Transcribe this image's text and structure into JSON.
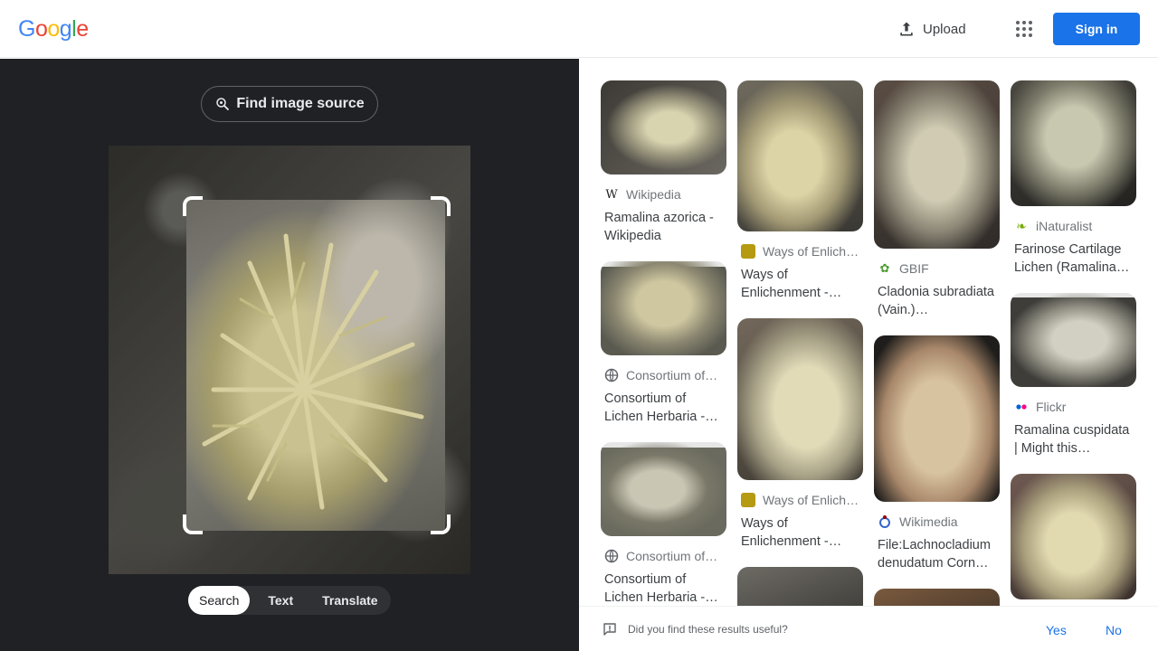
{
  "header": {
    "logo_letters": [
      {
        "ch": "G",
        "color": "#4285F4"
      },
      {
        "ch": "o",
        "color": "#EA4335"
      },
      {
        "ch": "o",
        "color": "#FBBC05"
      },
      {
        "ch": "g",
        "color": "#4285F4"
      },
      {
        "ch": "l",
        "color": "#34A853"
      },
      {
        "ch": "e",
        "color": "#EA4335"
      }
    ],
    "upload_label": "Upload",
    "apps_icon": "apps-grid-icon",
    "signin_label": "Sign in"
  },
  "left": {
    "find_source_label": "Find image source",
    "modes": [
      "Search",
      "Text",
      "Translate"
    ],
    "active_mode": "Search"
  },
  "results": [
    {
      "source": "Wikipedia",
      "source_icon": "wikipedia-icon",
      "title": "Ramalina azorica - Wikipedia"
    },
    {
      "source": "Consortium of…",
      "source_icon": "globe-icon",
      "title": "Consortium of Lichen Herbaria -…"
    },
    {
      "source": "Consortium of…",
      "source_icon": "globe-icon",
      "title": "Consortium of Lichen Herbaria -…"
    },
    {
      "source": "Ways of Enlich…",
      "source_icon": "site-favicon",
      "title": "Ways of Enlichenment -…"
    },
    {
      "source": "Ways of Enlich…",
      "source_icon": "site-favicon",
      "title": "Ways of Enlichenment -…"
    },
    {
      "source": "GBIF",
      "source_icon": "gbif-icon",
      "title": "Cladonia subradiata (Vain.)…"
    },
    {
      "source": "Wikimedia",
      "source_icon": "wikimedia-icon",
      "title": "File:Lachnocladium denudatum Corn…"
    },
    {
      "source": "iNaturalist",
      "source_icon": "inaturalist-icon",
      "title": "Farinose Cartilage Lichen (Ramalina…"
    },
    {
      "source": "Flickr",
      "source_icon": "flickr-icon",
      "title": "Ramalina cuspidata | Might this…"
    }
  ],
  "feedback": {
    "question": "Did you find these results useful?",
    "yes": "Yes",
    "no": "No"
  },
  "colors": {
    "accent": "#1a73e8",
    "dark_panel": "#202124"
  }
}
